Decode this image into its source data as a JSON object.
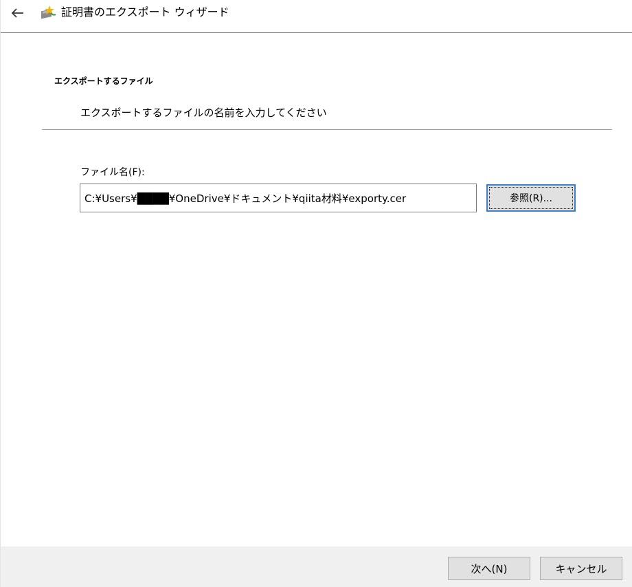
{
  "window": {
    "title": "証明書のエクスポート ウィザード"
  },
  "icons": {
    "back": "back-arrow-icon",
    "wizard": "certificate-wizard-icon"
  },
  "section": {
    "heading": "エクスポートするファイル",
    "description": "エクスポートするファイルの名前を入力してください"
  },
  "file_name": {
    "label": "ファイル名(F):",
    "value": "C:¥Users¥████¥OneDrive¥ドキュメント¥qiita材料¥exporty.cer"
  },
  "buttons": {
    "browse": "参照(R)...",
    "next": "次へ(N)",
    "cancel": "キャンセル"
  },
  "colors": {
    "focus_border": "#3c82c7",
    "button_face": "#e1e1e1",
    "footer_bg": "#f0f0f0"
  }
}
